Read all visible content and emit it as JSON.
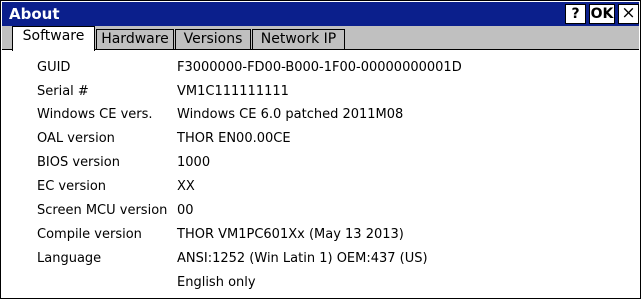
{
  "window": {
    "title": "About",
    "help_label": "?",
    "ok_label": "OK",
    "close_label": "×"
  },
  "tabs": [
    {
      "label": "Software",
      "active": true
    },
    {
      "label": "Hardware",
      "active": false
    },
    {
      "label": "Versions",
      "active": false
    },
    {
      "label": "Network IP",
      "active": false
    }
  ],
  "info": [
    {
      "label": "GUID",
      "value": "F3000000-FD00-B000-1F00-00000000001D"
    },
    {
      "label": "Serial #",
      "value": "VM1C111111111"
    },
    {
      "label": "Windows CE vers.",
      "value": "Windows CE 6.0 patched 2011M08"
    },
    {
      "label": "OAL version",
      "value": "THOR  EN00.00CE"
    },
    {
      "label": "BIOS version",
      "value": "1000"
    },
    {
      "label": "EC version",
      "value": "XX"
    },
    {
      "label": "Screen MCU version",
      "value": "00"
    },
    {
      "label": "Compile version",
      "value": "THOR  VM1PC601Xx (May 13 2013)"
    },
    {
      "label": "Language",
      "value": "ANSI:1252 (Win Latin 1) OEM:437 (US)"
    }
  ],
  "language_extra": "English only",
  "colors": {
    "titlebar": "#0b1f8c",
    "tab_strip": "#c0c0c0"
  }
}
